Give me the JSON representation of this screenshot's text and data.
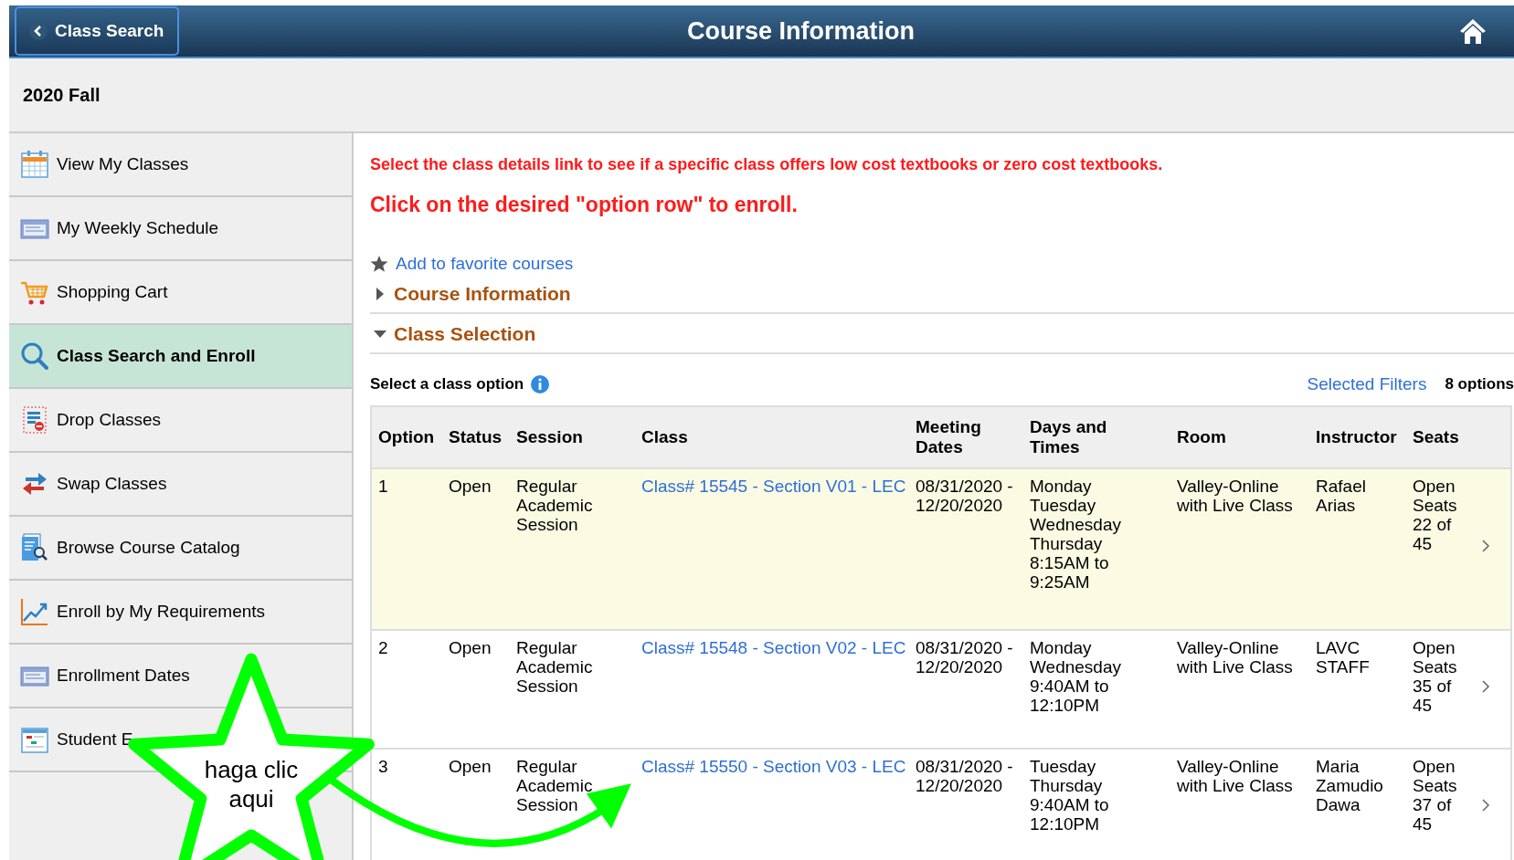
{
  "header": {
    "back_button": "Class Search",
    "title": "Course Information"
  },
  "term": "2020 Fall",
  "sidebar": {
    "items": [
      {
        "label": "View My Classes",
        "selected": false
      },
      {
        "label": "My Weekly Schedule",
        "selected": false
      },
      {
        "label": "Shopping Cart",
        "selected": false
      },
      {
        "label": "Class Search and Enroll",
        "selected": true
      },
      {
        "label": "Drop Classes",
        "selected": false
      },
      {
        "label": "Swap Classes",
        "selected": false
      },
      {
        "label": "Browse Course Catalog",
        "selected": false
      },
      {
        "label": "Enroll by My Requirements",
        "selected": false
      },
      {
        "label": "Enrollment Dates",
        "selected": false
      },
      {
        "label": "Student E",
        "selected": false
      }
    ]
  },
  "notices": [
    "Select the class details link to see if a specific class offers low cost textbooks or zero cost textbooks.",
    "Click on the desired \"option row\" to enroll."
  ],
  "favorite_link": "Add to favorite courses",
  "sections": [
    {
      "title": "Course Information",
      "expanded": false
    },
    {
      "title": "Class Selection",
      "expanded": true
    }
  ],
  "class_selection": {
    "label": "Select a class option",
    "filters_link": "Selected Filters",
    "count": "8 options",
    "columns": [
      "Option",
      "Status",
      "Session",
      "Class",
      "Meeting\nDates",
      "Days and\nTimes",
      "Room",
      "Instructor",
      "Seats"
    ],
    "rows": [
      {
        "selected": true,
        "cells": [
          "1",
          "Open",
          "Regular\nAcademic\nSession",
          "Class# 15545 - Section V01 - LEC",
          "08/31/2020 -\n12/20/2020",
          "Monday\nTuesday\nWednesday\nThursday\n8:15AM to\n9:25AM",
          "Valley-Online\nwith Live Class",
          "Rafael\nArias",
          "Open\nSeats\n22 of\n45"
        ]
      },
      {
        "selected": false,
        "cells": [
          "2",
          "Open",
          "Regular\nAcademic\nSession",
          "Class# 15548 - Section V02 - LEC",
          "08/31/2020 -\n12/20/2020",
          "Monday\nWednesday\n9:40AM to\n12:10PM",
          "Valley-Online\nwith Live Class",
          "LAVC\nSTAFF",
          "Open\nSeats\n35 of\n45"
        ]
      },
      {
        "selected": false,
        "cells": [
          "3",
          "Open",
          "Regular\nAcademic\nSession",
          "Class# 15550 - Section V03 - LEC",
          "08/31/2020 -\n12/20/2020",
          "Tuesday\nThursday\n9:40AM to\n12:10PM",
          "Valley-Online\nwith Live Class",
          "Maria\nZamudio\nDawa",
          "Open\nSeats\n37 of\n45"
        ]
      }
    ]
  },
  "callout": {
    "text": "haga clic\naqui"
  }
}
